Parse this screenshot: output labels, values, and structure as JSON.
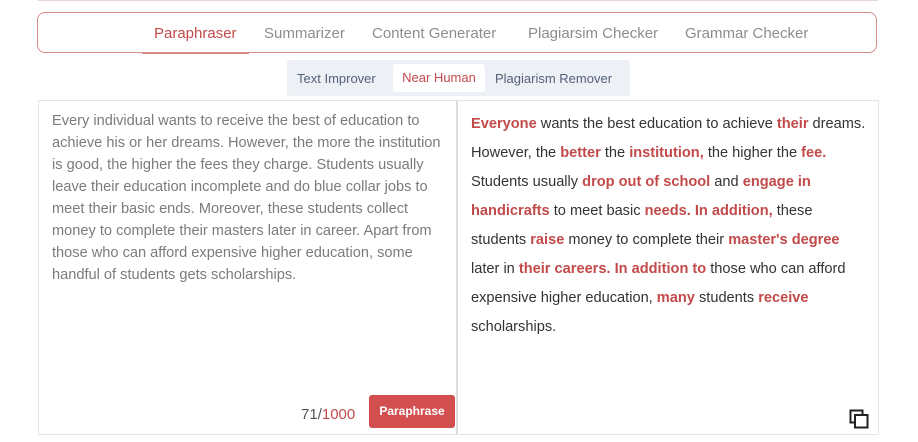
{
  "tool_tabs": [
    {
      "label": "Paraphraser",
      "active": true
    },
    {
      "label": "Summarizer",
      "active": false
    },
    {
      "label": "Content Generater",
      "active": false
    },
    {
      "label": "Plagiarsim Checker",
      "active": false
    },
    {
      "label": "Grammar Checker",
      "active": false
    }
  ],
  "mode_tabs": [
    {
      "label": "Text Improver",
      "active": false
    },
    {
      "label": "Near Human",
      "active": true
    },
    {
      "label": "Plagiarism Remover",
      "active": false
    }
  ],
  "input": {
    "text": "Every individual wants to receive the best of education to achieve his or her dreams. However, the more the institution is good, the higher the fees they charge. Students usually leave their education incomplete and do blue collar jobs to meet their basic ends. Moreover, these students collect money to complete their masters later in career. Apart from those who can afford expensive higher education, some handful of students gets scholarships."
  },
  "counter": {
    "current": "71",
    "separator": "/",
    "max": "1000"
  },
  "paraphrase_button": "Paraphrase",
  "output_segments": [
    {
      "text": "Everyone",
      "changed": true
    },
    {
      "text": " wants the best education to achieve ",
      "changed": false
    },
    {
      "text": "their",
      "changed": true
    },
    {
      "text": " dreams. However, the ",
      "changed": false
    },
    {
      "text": "better",
      "changed": true
    },
    {
      "text": " the ",
      "changed": false
    },
    {
      "text": "institution,",
      "changed": true
    },
    {
      "text": " the higher the ",
      "changed": false
    },
    {
      "text": "fee.",
      "changed": true
    },
    {
      "text": " Students usually ",
      "changed": false
    },
    {
      "text": "drop out of school",
      "changed": true
    },
    {
      "text": " and ",
      "changed": false
    },
    {
      "text": "engage in handicrafts",
      "changed": true
    },
    {
      "text": " to meet basic ",
      "changed": false
    },
    {
      "text": "needs. In addition,",
      "changed": true
    },
    {
      "text": " these students ",
      "changed": false
    },
    {
      "text": "raise",
      "changed": true
    },
    {
      "text": " money to complete their ",
      "changed": false
    },
    {
      "text": "master's degree",
      "changed": true
    },
    {
      "text": " later in ",
      "changed": false
    },
    {
      "text": "their careers. In addition to",
      "changed": true
    },
    {
      "text": " those who can afford expensive higher education, ",
      "changed": false
    },
    {
      "text": "many",
      "changed": true
    },
    {
      "text": " students ",
      "changed": false
    },
    {
      "text": "receive",
      "changed": true
    },
    {
      "text": " scholarships.",
      "changed": false
    }
  ],
  "icons": {
    "copy": "copy-icon"
  },
  "colors": {
    "accent": "#c24a4a",
    "button": "#d34f4f",
    "mode_bar": "#edf0f4"
  }
}
